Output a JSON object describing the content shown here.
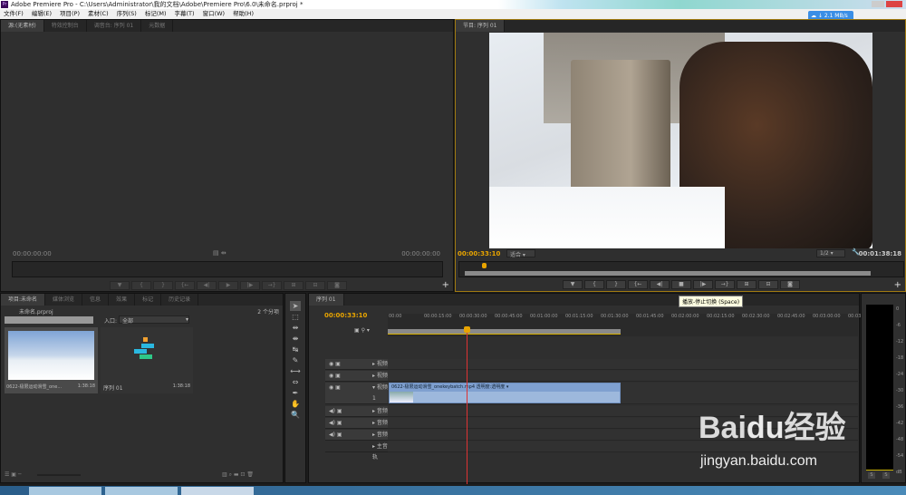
{
  "window": {
    "title": "Adobe Premiere Pro - C:\\Users\\Administrator\\我的文档\\Adobe\\Premiere Pro\\6.0\\未命名.prproj *",
    "app_icon": "Pr",
    "net_speed": "↓ 2.1 MB/s"
  },
  "menu": [
    "文件(F)",
    "编辑(E)",
    "项目(P)",
    "素材(C)",
    "序列(S)",
    "标记(M)",
    "字幕(T)",
    "窗口(W)",
    "帮助(H)"
  ],
  "source": {
    "tabs": [
      "源:(无素材)",
      "特效控制台",
      "调音台: 序列 01",
      "元数据"
    ],
    "tc_left": "00:00:00:00",
    "tc_right": "00:00:00:00"
  },
  "program": {
    "tab": "节目: 序列 01",
    "tc_current": "00:00:33:10",
    "fit": "适合",
    "resolution": "1/2",
    "tc_duration": "00:01:38:18",
    "tooltip": "播放-停止切换 (Space)"
  },
  "project": {
    "tabs": [
      "项目:未命名",
      "媒体浏览",
      "信息",
      "效果",
      "标记",
      "历史记录"
    ],
    "file": "未命名.prproj",
    "count": "2 个分项",
    "search_placeholder": "",
    "in_label": "入口:",
    "in_value": "全部",
    "items": [
      {
        "name": "0622-极限运动滑雪_one...",
        "duration": "1:38:18"
      },
      {
        "name": "序列 01",
        "duration": "1:38:18"
      }
    ]
  },
  "timeline": {
    "tab": "序列 01",
    "timecode": "00:00:33:10",
    "ruler": [
      "00:00",
      "00:00:15:00",
      "00:00:30:00",
      "00:00:45:00",
      "00:01:00:00",
      "00:01:15:00",
      "00:01:30:00",
      "00:01:45:00",
      "00:02:00:00",
      "00:02:15:00",
      "00:02:30:00",
      "00:02:45:00",
      "00:03:00:00",
      "00:03:1"
    ],
    "tracks": {
      "v3": "视频 3",
      "v2": "视频 2",
      "v1": "视频 1",
      "a1": "音频 1",
      "a2": "音频 2",
      "a3": "音频 3",
      "master": "主音轨"
    },
    "clip": {
      "label": "0622-极限运动滑雪_onekeybatch.mp4",
      "fx": "透明度:透明度"
    },
    "playhead_seconds": 33.4
  },
  "meter": {
    "scale": [
      "0",
      "-6",
      "-12",
      "-18",
      "-24",
      "-30",
      "-36",
      "-42",
      "-48",
      "-54",
      "dB"
    ],
    "solo": [
      "S",
      "S"
    ]
  },
  "watermark": {
    "brand": "Baidu经验",
    "url": "jingyan.baidu.com"
  }
}
